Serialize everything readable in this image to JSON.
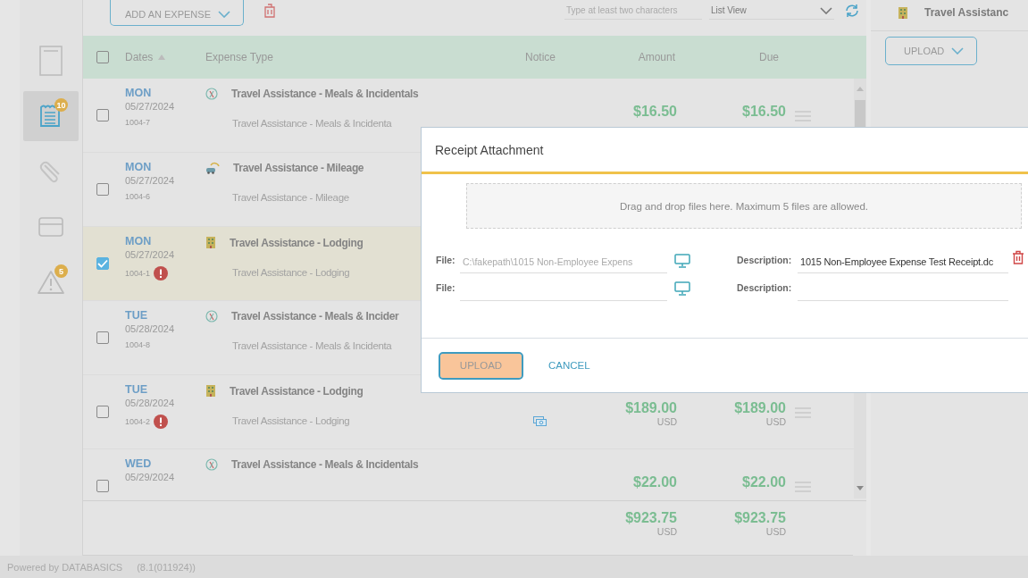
{
  "rail": [
    {
      "kind": "document",
      "selected": false
    },
    {
      "kind": "report",
      "badge": "10",
      "selected": true
    },
    {
      "kind": "paperclip",
      "selected": false
    },
    {
      "kind": "card",
      "selected": false
    },
    {
      "kind": "warning",
      "badge": "5",
      "selected": false
    }
  ],
  "toolbar": {
    "add_button": "ADD AN EXPENSE",
    "search": {
      "placeholder": "Type at least two characters"
    },
    "view_select": "List View"
  },
  "table": {
    "columns": [
      {
        "label": "Dates",
        "sorted": true
      },
      {
        "label": "Expense Type"
      },
      {
        "label": "Notice"
      },
      {
        "label": "Amount"
      },
      {
        "label": "Due"
      }
    ],
    "header_checked": false,
    "rows": [
      {
        "day": "MON",
        "date": "05/27/2024",
        "ref": "1004-7",
        "selected": false,
        "kind": "meals",
        "title": "Travel Assistance - Meals & Incidentals",
        "subtitle": "Travel Assistance - Meals & Incidenta",
        "amount": "$16.50",
        "due": "$16.50"
      },
      {
        "day": "MON",
        "date": "05/27/2024",
        "ref": "1004-6",
        "selected": false,
        "kind": "mileage",
        "title": "Travel Assistance - Mileage",
        "subtitle": "Travel Assistance - Mileage"
      },
      {
        "day": "MON",
        "date": "05/27/2024",
        "ref": "1004-1",
        "alert": true,
        "selected": true,
        "kind": "lodging",
        "title": "Travel Assistance - Lodging",
        "subtitle": "Travel Assistance - Lodging"
      },
      {
        "day": "TUE",
        "date": "05/28/2024",
        "ref": "1004-8",
        "selected": false,
        "kind": "meals",
        "title": "Travel Assistance - Meals & Incider",
        "subtitle": "Travel Assistance - Meals & Incidenta"
      },
      {
        "day": "TUE",
        "date": "05/28/2024",
        "ref": "1004-2",
        "alert": true,
        "selected": false,
        "kind": "lodging",
        "title": "Travel Assistance - Lodging",
        "subtitle": "Travel Assistance - Lodging",
        "notice": true,
        "amount": "$189.00",
        "amount_currency": "USD",
        "due": "$189.00",
        "due_currency": "USD"
      },
      {
        "day": "WED",
        "date": "05/29/2024",
        "selected": false,
        "kind": "meals",
        "title": "Travel Assistance - Meals & Incidentals",
        "amount": "$22.00",
        "due": "$22.00"
      }
    ],
    "total": {
      "amount": "$923.75",
      "amount_currency": "USD",
      "due": "$923.75",
      "due_currency": "USD"
    }
  },
  "side_panel": {
    "title": "Travel Assistanc",
    "upload_button": "UPLOAD"
  },
  "footer": {
    "powered_by": "Powered by DATABASICS",
    "version": "(8.1(011924))"
  },
  "dialog": {
    "title": "Receipt Attachment",
    "dropzone": "Drag and drop files here. Maximum 5 files are allowed.",
    "files": [
      {
        "label": "File:",
        "value": "C:\\fakepath\\1015 Non-Employee Expens",
        "description_label": "Description:",
        "description": "1015 Non-Employee Expense Test Receipt.dc",
        "removable": true
      },
      {
        "label": "File:",
        "description_label": "Description:"
      }
    ],
    "buttons": [
      {
        "label": "UPLOAD",
        "kind": "outlined",
        "highlighted": true
      },
      {
        "label": "CANCEL",
        "kind": "link",
        "highlighted": false
      }
    ]
  }
}
